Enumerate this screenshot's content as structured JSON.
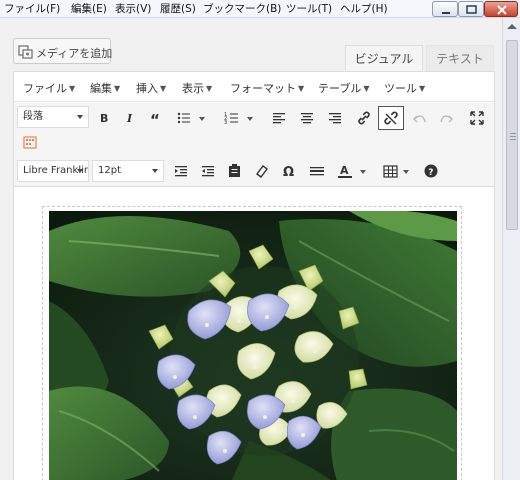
{
  "browser": {
    "menu": [
      "ファイル(F)",
      "編集(E)",
      "表示(V)",
      "履歴(S)",
      "ブックマーク(B)",
      "ツール(T)",
      "ヘルプ(H)"
    ]
  },
  "editor": {
    "add_media": "メディアを追加",
    "tabs": {
      "visual": "ビジュアル",
      "text": "テキスト"
    },
    "menubar": [
      "ファイル",
      "編集",
      "挿入",
      "表示",
      "フォーマット",
      "テーブル",
      "ツール"
    ],
    "format_select": "段落",
    "font_family": "Libre Franklin",
    "font_size": "12pt"
  },
  "icons": {
    "row1": [
      "bold-icon",
      "italic-icon",
      "blockquote-icon",
      "bullet-list-icon",
      "numbered-list-icon",
      "align-left-icon",
      "align-center-icon",
      "align-right-icon",
      "link-icon",
      "unlink-icon",
      "undo-icon",
      "redo-icon",
      "fullscreen-icon"
    ],
    "row1b": [
      "toolbar-toggle-icon"
    ],
    "row2": [
      "indent-icon",
      "outdent-icon",
      "paste-text-icon",
      "clear-format-icon",
      "special-char-icon",
      "horizontal-line-icon",
      "text-color-icon",
      "table-icon",
      "help-icon"
    ]
  },
  "colors": {
    "accent_orange": "#e8864a",
    "text_color_underline": "#333333"
  },
  "content": {
    "image": "hydrangea-photo"
  }
}
